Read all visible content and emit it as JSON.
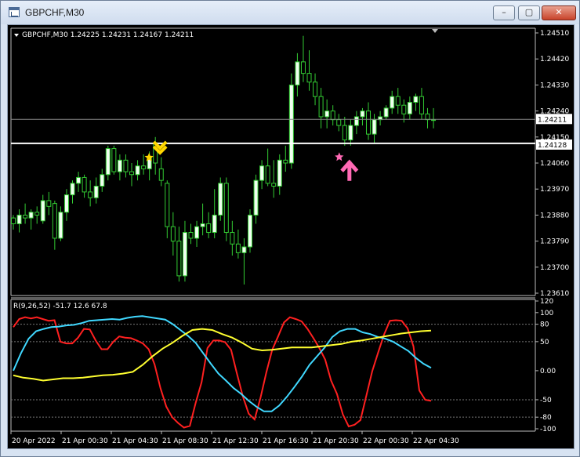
{
  "window": {
    "title": "GBPCHF,M30",
    "minimize_glyph": "–",
    "maximize_glyph": "▢",
    "close_glyph": "✕"
  },
  "chart": {
    "symbol_header": "GBPCHF,M30  1.24225 1.24231 1.24167 1.24211",
    "price_axis_labels": [
      "1.24510",
      "1.24420",
      "1.24330",
      "1.24240",
      "1.24150",
      "1.24060",
      "1.23970",
      "1.23880",
      "1.23790",
      "1.23700",
      "1.23610"
    ],
    "current_price_label": "1.24211",
    "hline_price_label": "1.24128",
    "time_labels": [
      "20 Apr 2022",
      "21 Apr 00:30",
      "21 Apr 04:30",
      "21 Apr 08:30",
      "21 Apr 12:30",
      "21 Apr 16:30",
      "21 Apr 20:30",
      "22 Apr 00:30",
      "22 Apr 04:30"
    ],
    "indicator_header": "R(9,26,52) -51.7 12.6 67.8",
    "indicator_axis_labels": [
      "120",
      "100",
      "80",
      "50",
      "0.00",
      "-50",
      "-80",
      "-100"
    ]
  },
  "chart_data": {
    "type": "candlestick",
    "ylim": [
      1.2361,
      1.2451
    ],
    "up_color": "#f0fff0",
    "down_color": "#000000",
    "wick_color": "#33cc33",
    "ohlc": [
      [
        1.2387,
        1.2388,
        1.2383,
        1.2385
      ],
      [
        1.2385,
        1.239,
        1.2382,
        1.2388
      ],
      [
        1.2388,
        1.2392,
        1.2385,
        1.2387
      ],
      [
        1.2387,
        1.239,
        1.2383,
        1.2389
      ],
      [
        1.2389,
        1.2391,
        1.2385,
        1.2388
      ],
      [
        1.2386,
        1.2395,
        1.2385,
        1.2393
      ],
      [
        1.2393,
        1.2396,
        1.2388,
        1.2391
      ],
      [
        1.2392,
        1.2393,
        1.2376,
        1.238
      ],
      [
        1.238,
        1.2391,
        1.2379,
        1.2389
      ],
      [
        1.2389,
        1.2397,
        1.2386,
        1.2395
      ],
      [
        1.2395,
        1.24,
        1.2392,
        1.2399
      ],
      [
        1.2399,
        1.2403,
        1.2396,
        1.2401
      ],
      [
        1.2401,
        1.2402,
        1.2394,
        1.2396
      ],
      [
        1.2396,
        1.24,
        1.2391,
        1.2394
      ],
      [
        1.2394,
        1.2401,
        1.2392,
        1.2398
      ],
      [
        1.2398,
        1.2404,
        1.2396,
        1.2402
      ],
      [
        1.2402,
        1.2412,
        1.24,
        1.2411
      ],
      [
        1.2411,
        1.2412,
        1.2402,
        1.2403
      ],
      [
        1.2403,
        1.2409,
        1.24,
        1.2407
      ],
      [
        1.2407,
        1.2409,
        1.2401,
        1.2403
      ],
      [
        1.2403,
        1.2406,
        1.2398,
        1.2402
      ],
      [
        1.2402,
        1.2407,
        1.24,
        1.2405
      ],
      [
        1.2405,
        1.2409,
        1.2402,
        1.2404
      ],
      [
        1.2404,
        1.241,
        1.24,
        1.2408
      ],
      [
        1.2413,
        1.2415,
        1.2402,
        1.2406
      ],
      [
        1.2404,
        1.2408,
        1.2398,
        1.24
      ],
      [
        1.2399,
        1.24,
        1.238,
        1.2384
      ],
      [
        1.2384,
        1.2389,
        1.2374,
        1.2379
      ],
      [
        1.2379,
        1.2384,
        1.2365,
        1.2367
      ],
      [
        1.2367,
        1.2386,
        1.2365,
        1.2382
      ],
      [
        1.2382,
        1.2385,
        1.2378,
        1.238
      ],
      [
        1.238,
        1.2386,
        1.2377,
        1.2384
      ],
      [
        1.2384,
        1.2392,
        1.2381,
        1.2385
      ],
      [
        1.2385,
        1.2389,
        1.238,
        1.2382
      ],
      [
        1.2382,
        1.2397,
        1.238,
        1.2388
      ],
      [
        1.2388,
        1.2401,
        1.2386,
        1.2399
      ],
      [
        1.2399,
        1.2401,
        1.2379,
        1.2382
      ],
      [
        1.2382,
        1.2386,
        1.2374,
        1.2378
      ],
      [
        1.2378,
        1.2383,
        1.2373,
        1.2375
      ],
      [
        1.2375,
        1.238,
        1.2364,
        1.2377
      ],
      [
        1.2377,
        1.239,
        1.2375,
        1.2388
      ],
      [
        1.2388,
        1.2402,
        1.2385,
        1.24
      ],
      [
        1.24,
        1.2407,
        1.2397,
        1.2405
      ],
      [
        1.2405,
        1.2411,
        1.2398,
        1.2399
      ],
      [
        1.2399,
        1.2407,
        1.2394,
        1.2398
      ],
      [
        1.2398,
        1.2409,
        1.2395,
        1.2407
      ],
      [
        1.2407,
        1.2412,
        1.2403,
        1.2406
      ],
      [
        1.2406,
        1.2437,
        1.2404,
        1.2433
      ],
      [
        1.2433,
        1.2444,
        1.2429,
        1.2441
      ],
      [
        1.2441,
        1.245,
        1.2434,
        1.2437
      ],
      [
        1.2437,
        1.2445,
        1.2431,
        1.2434
      ],
      [
        1.2434,
        1.2437,
        1.2426,
        1.2429
      ],
      [
        1.2429,
        1.2432,
        1.2418,
        1.2422
      ],
      [
        1.2422,
        1.2428,
        1.2418,
        1.2424
      ],
      [
        1.2424,
        1.2426,
        1.2419,
        1.2421
      ],
      [
        1.2421,
        1.2423,
        1.2417,
        1.2419
      ],
      [
        1.2419,
        1.2422,
        1.2412,
        1.2414
      ],
      [
        1.2414,
        1.2421,
        1.2412,
        1.2419
      ],
      [
        1.2419,
        1.2424,
        1.2416,
        1.2422
      ],
      [
        1.2422,
        1.2425,
        1.2419,
        1.2424
      ],
      [
        1.2424,
        1.2427,
        1.2414,
        1.2416
      ],
      [
        1.2416,
        1.2423,
        1.2413,
        1.2421
      ],
      [
        1.2421,
        1.2424,
        1.2419,
        1.2422
      ],
      [
        1.2422,
        1.2426,
        1.2421,
        1.2425
      ],
      [
        1.2425,
        1.2431,
        1.2423,
        1.2429
      ],
      [
        1.2429,
        1.2432,
        1.2423,
        1.2426
      ],
      [
        1.2426,
        1.2428,
        1.242,
        1.2423
      ],
      [
        1.2423,
        1.2429,
        1.2421,
        1.2427
      ],
      [
        1.2427,
        1.243,
        1.2424,
        1.2429
      ],
      [
        1.2429,
        1.2432,
        1.2421,
        1.2423
      ],
      [
        1.2423,
        1.2425,
        1.2418,
        1.2421
      ],
      [
        1.2421,
        1.2425,
        1.2418,
        1.2421
      ]
    ],
    "hline_price": 1.24128,
    "current_price": 1.24211,
    "signals": [
      {
        "type": "sell",
        "index": 24,
        "price": 1.2409,
        "color": "#ffd700"
      },
      {
        "type": "buy",
        "index": 56,
        "price": 1.2407,
        "color": "#ff69b4"
      }
    ],
    "indicator": {
      "name": "R(9,26,52)",
      "ylim": [
        -100,
        120
      ],
      "levels": [
        80,
        50,
        -50,
        -80
      ],
      "series": [
        {
          "color": "#ff2020",
          "values": [
            75,
            89,
            92,
            90,
            92,
            89,
            86,
            87,
            50,
            47,
            47,
            57,
            72,
            71,
            52,
            37,
            37,
            50,
            59,
            57,
            56,
            52,
            47,
            37,
            11,
            -30,
            -62,
            -80,
            -90,
            -98,
            -95,
            -55,
            -20,
            39,
            52,
            52,
            49,
            36,
            -5,
            -44,
            -74,
            -84,
            -47,
            -3,
            36,
            59,
            83,
            92,
            89,
            85,
            72,
            56,
            39,
            19,
            -17,
            -40,
            -75,
            -96,
            -93,
            -85,
            -43,
            -1,
            31,
            62,
            86,
            87,
            86,
            73,
            42,
            -34,
            -50,
            -52
          ]
        },
        {
          "color": "#40d8ff",
          "values": [
            0,
            30,
            55,
            68,
            72,
            75,
            76,
            78,
            79,
            82,
            86,
            87,
            88,
            89,
            88,
            91,
            93,
            94,
            92,
            90,
            88,
            80,
            70,
            60,
            48,
            30,
            12,
            -5,
            -17,
            -30,
            -40,
            -52,
            -62,
            -70,
            -70,
            -60,
            -45,
            -28,
            -10,
            10,
            25,
            40,
            58,
            68,
            72,
            72,
            66,
            63,
            58,
            55,
            50,
            42,
            34,
            22,
            12,
            5
          ]
        },
        {
          "color": "#ffff30",
          "values": [
            -8,
            -12,
            -14,
            -17,
            -15,
            -13,
            -13,
            -12,
            -10,
            -8,
            -7,
            -5,
            -2,
            10,
            25,
            38,
            48,
            60,
            70,
            72,
            70,
            63,
            57,
            48,
            38,
            35,
            36,
            38,
            40,
            40,
            40,
            42,
            44,
            46,
            50,
            52,
            55,
            58,
            61,
            64,
            66,
            68,
            69
          ]
        }
      ]
    }
  }
}
